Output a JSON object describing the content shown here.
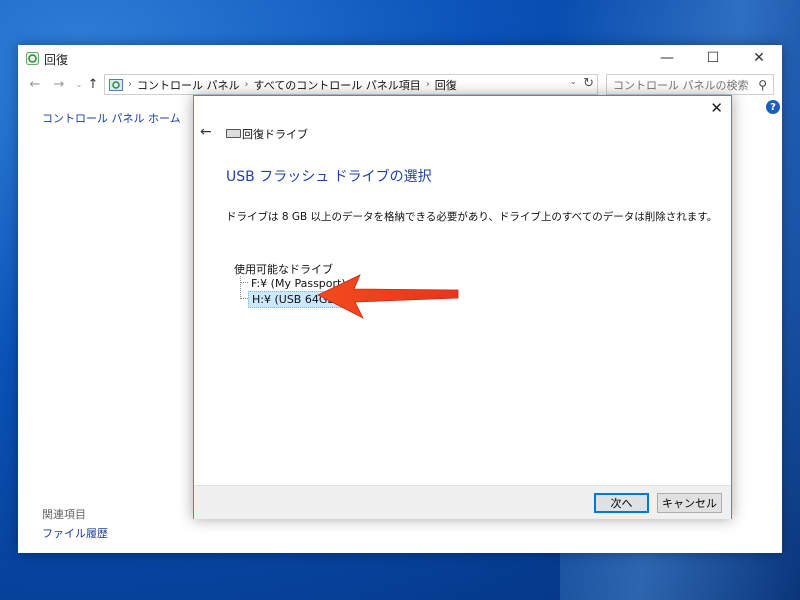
{
  "window": {
    "title": "回復",
    "controls": {
      "minimize": "—",
      "maximize": "☐",
      "close": "✕"
    }
  },
  "address_bar": {
    "breadcrumbs": [
      "コントロール パネル",
      "すべてのコントロール パネル項目",
      "回復"
    ],
    "search_placeholder": "コントロール パネルの検索"
  },
  "sidebar": {
    "home_link": "コントロール パネル ホーム",
    "related_title": "関連項目",
    "related_links": [
      "ファイル履歴"
    ]
  },
  "dialog": {
    "app_title": "回復ドライブ",
    "heading": "USB フラッシュ ドライブの選択",
    "description": "ドライブは 8 GB 以上のデータを格納できる必要があり、ドライブ上のすべてのデータは削除されます。",
    "drives_label": "使用可能なドライブ",
    "drives": [
      {
        "label": "F:¥ (My Passport)",
        "selected": false
      },
      {
        "label": "H:¥ (USB 64GB)",
        "selected": true
      }
    ],
    "buttons": {
      "next": "次へ",
      "cancel": "キャンセル"
    }
  },
  "colors": {
    "accent": "#1f43a8",
    "link": "#1b3c9e",
    "selection": "#cce8ff",
    "annotation_arrow": "#e8341c"
  },
  "icons": {
    "help": "?",
    "back": "←",
    "forward": "→",
    "up": "↑",
    "refresh": "↻",
    "search": "⚲",
    "close": "✕"
  }
}
